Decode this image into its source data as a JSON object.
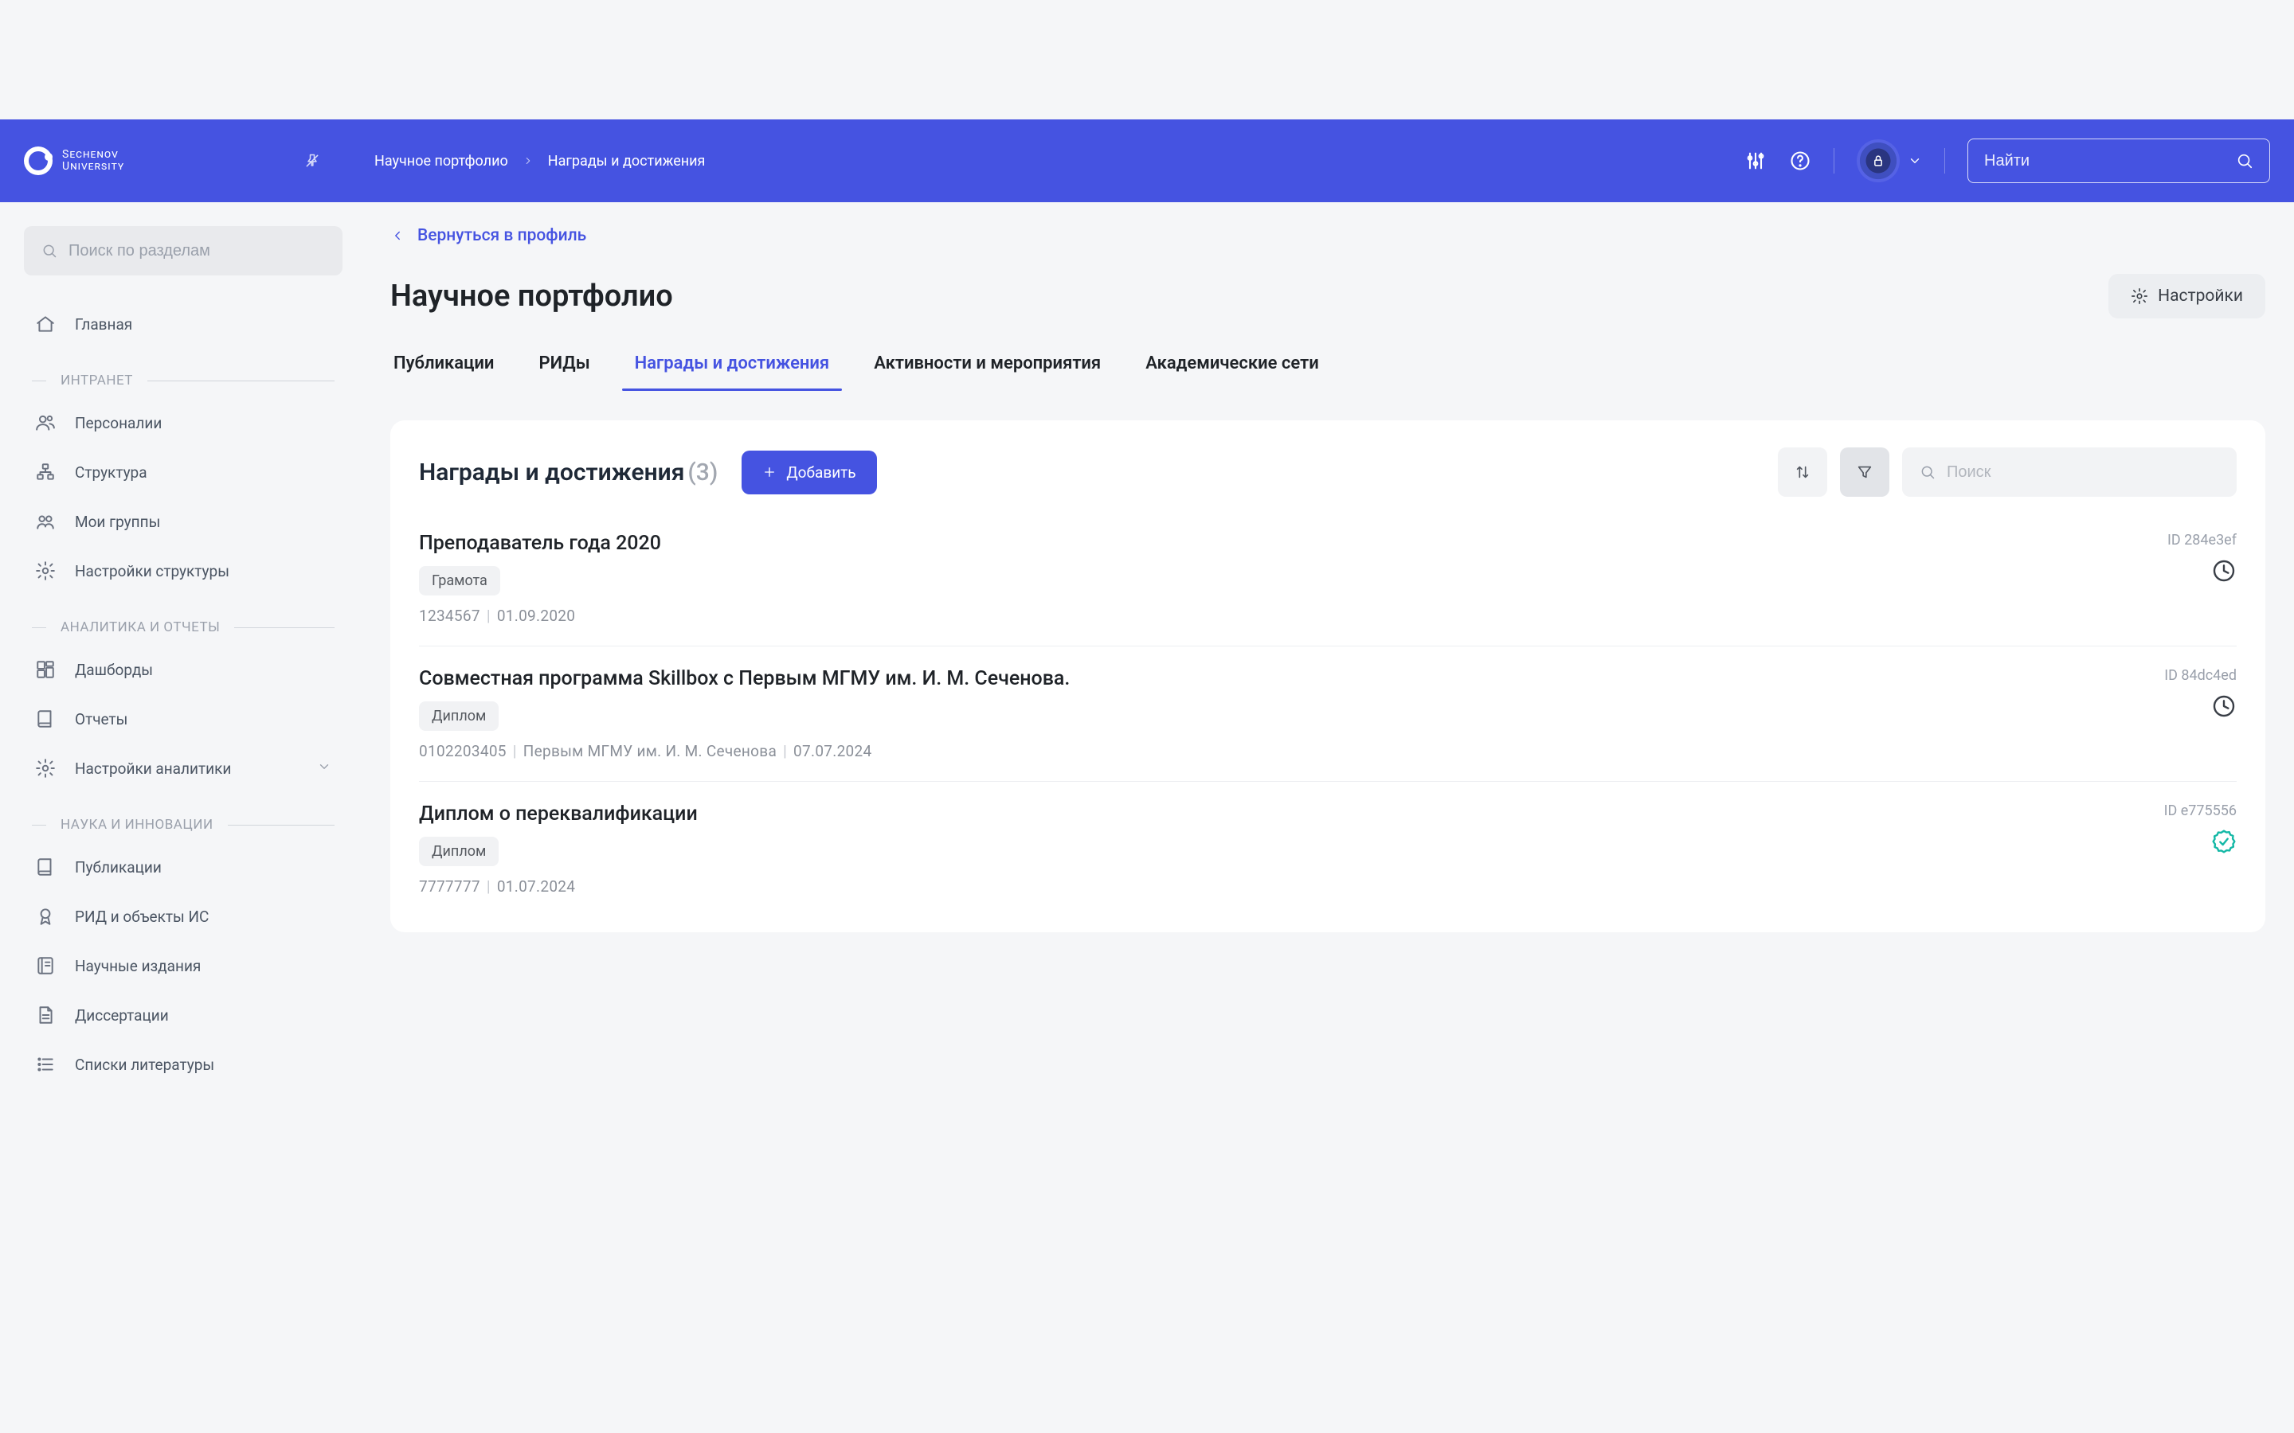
{
  "brand": {
    "line1": "Sechenov",
    "line2": "University"
  },
  "breadcrumb": {
    "root": "Научное портфолио",
    "leaf": "Награды и достижения"
  },
  "header": {
    "search_placeholder": "Найти"
  },
  "sidebar": {
    "search_placeholder": "Поиск по разделам",
    "home": "Главная",
    "sections": [
      {
        "title": "ИНТРАНЕТ",
        "items": [
          {
            "icon": "users",
            "label": "Персоналии"
          },
          {
            "icon": "tree",
            "label": "Структура"
          },
          {
            "icon": "groups",
            "label": "Мои группы"
          },
          {
            "icon": "gear",
            "label": "Настройки структуры"
          }
        ]
      },
      {
        "title": "АНАЛИТИКА И ОТЧЕТЫ",
        "items": [
          {
            "icon": "dashboard",
            "label": "Дашборды"
          },
          {
            "icon": "book",
            "label": "Отчеты"
          },
          {
            "icon": "gear",
            "label": "Настройки аналитики",
            "expandable": true
          }
        ]
      },
      {
        "title": "НАУКА И ИННОВАЦИИ",
        "items": [
          {
            "icon": "book",
            "label": "Публикации"
          },
          {
            "icon": "medal",
            "label": "РИД и объекты ИС"
          },
          {
            "icon": "journal",
            "label": "Научные издания"
          },
          {
            "icon": "doc",
            "label": "Диссертации"
          },
          {
            "icon": "list",
            "label": "Списки литературы"
          }
        ]
      }
    ]
  },
  "back_link": "Вернуться в профиль",
  "page_title": "Научное портфолио",
  "settings_btn": "Настройки",
  "tabs": [
    "Публикации",
    "РИДы",
    "Награды и достижения",
    "Активности и мероприятия",
    "Академические сети"
  ],
  "tabs_active_index": 2,
  "panel": {
    "title": "Награды и достижения",
    "count": "(3)",
    "add_btn": "Добавить",
    "search_placeholder": "Поиск"
  },
  "items": [
    {
      "title": "Преподаватель года 2020",
      "id": "ID 284e3ef",
      "badge": "Грамота",
      "meta": [
        "1234567",
        "01.09.2020"
      ],
      "status": "pending"
    },
    {
      "title": "Совместная программа Skillbox с Первым МГМУ им. И. М. Сеченова.",
      "id": "ID 84dc4ed",
      "badge": "Диплом",
      "meta": [
        "0102203405",
        "Первым МГМУ им. И. М. Сеченова",
        "07.07.2024"
      ],
      "status": "pending"
    },
    {
      "title": "Диплом о переквалификации",
      "id": "ID e775556",
      "badge": "Диплом",
      "meta": [
        "7777777",
        "01.07.2024"
      ],
      "status": "verified"
    }
  ]
}
